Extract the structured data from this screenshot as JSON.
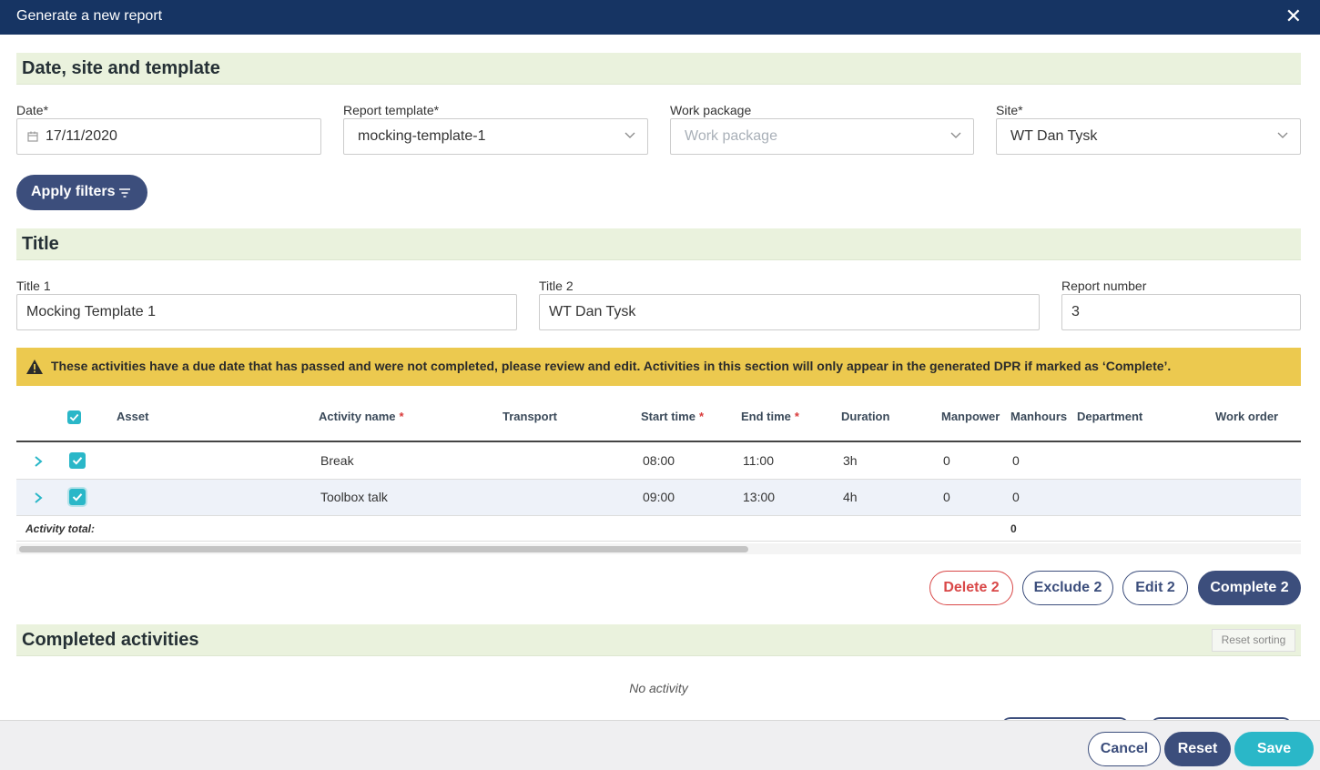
{
  "dialog": {
    "title": "Generate a new report"
  },
  "section_date": {
    "title": "Date, site and template"
  },
  "fields": {
    "date": {
      "label": "Date*",
      "value": "17/11/2020"
    },
    "report_template": {
      "label": "Report template*",
      "value": "mocking-template-1"
    },
    "work_package": {
      "label": "Work package",
      "placeholder": "Work package"
    },
    "site": {
      "label": "Site*",
      "value": "WT Dan Tysk"
    }
  },
  "apply_filters": {
    "label": "Apply filters"
  },
  "section_title": {
    "title": "Title"
  },
  "titles": {
    "title1": {
      "label": "Title 1",
      "value": "Mocking Template 1"
    },
    "title2": {
      "label": "Title 2",
      "value": "WT Dan Tysk"
    },
    "report_number": {
      "label": "Report number",
      "value": "3"
    }
  },
  "warning": {
    "text": "These activities have a due date that has passed and were not completed, please review and edit. Activities in this section will only appear in the generated DPR if marked as ‘Complete’."
  },
  "table": {
    "required_mark": "*",
    "columns": {
      "asset": "Asset",
      "activity_name": "Activity name",
      "transport": "Transport",
      "start_time": "Start time",
      "end_time": "End time",
      "duration": "Duration",
      "manpower": "Manpower",
      "manhours": "Manhours",
      "department": "Department",
      "work_order": "Work order"
    },
    "rows": [
      {
        "activity_name": "Break",
        "start_time": "08:00",
        "end_time": "11:00",
        "duration": "3h",
        "manpower": "0",
        "manhours": "0",
        "checked": true
      },
      {
        "activity_name": "Toolbox talk",
        "start_time": "09:00",
        "end_time": "13:00",
        "duration": "4h",
        "manpower": "0",
        "manhours": "0",
        "checked": true
      }
    ],
    "total": {
      "label": "Activity total:",
      "manhours": "0"
    }
  },
  "actions": {
    "delete": "Delete 2",
    "exclude": "Exclude 2",
    "edit": "Edit 2",
    "complete": "Complete 2"
  },
  "section_completed": {
    "title": "Completed activities",
    "reset_sorting": "Reset sorting",
    "empty": "No activity"
  },
  "footer": {
    "cancel": "Cancel",
    "reset": "Reset",
    "save": "Save"
  },
  "colors": {
    "header_bg": "#163463",
    "section_bg": "#eaf2dd",
    "primary": "#3c4e7c",
    "accent": "#2ab7c8",
    "warning": "#ecc94f",
    "danger": "#d94848"
  }
}
